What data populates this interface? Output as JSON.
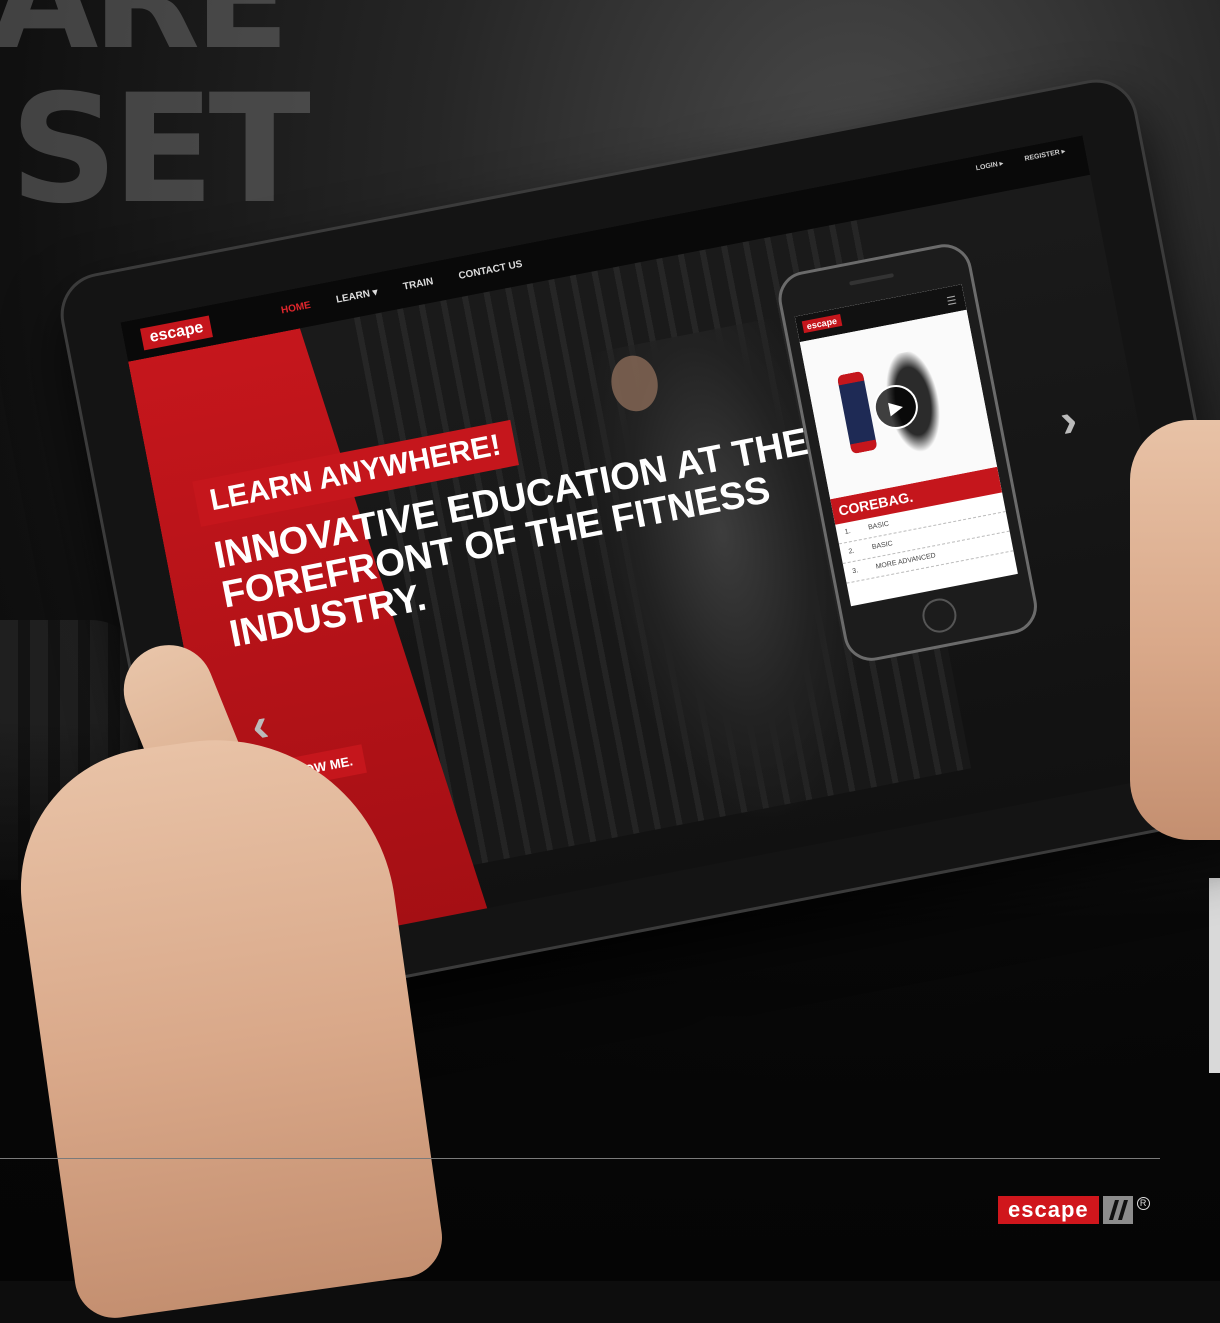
{
  "tablet_site": {
    "logo": "escape",
    "nav": [
      "HOME",
      "LEARN ▾",
      "TRAIN",
      "CONTACT US"
    ],
    "top_links": [
      "LOGIN ▸",
      "REGISTER ▸"
    ],
    "ribbon": "LEARN ANYWHERE!",
    "headline": "INNOVATIVE EDUCATION AT THE FOREFRONT OF THE FITNESS INDUSTRY.",
    "cta": "SHOW ME.",
    "prev_icon": "‹",
    "next_icon": "›"
  },
  "phone_site": {
    "logo": "escape",
    "menu_icon": "☰",
    "play_icon": "▶",
    "title": "COREBAG.",
    "rows": [
      {
        "num": "1.",
        "text": "BASIC"
      },
      {
        "num": "2.",
        "text": "BASIC"
      },
      {
        "num": "3.",
        "text": "MORE ADVANCED"
      }
    ]
  },
  "footer": {
    "logo_text": "escape",
    "registered": "R"
  },
  "colors": {
    "brand_red": "#c5161c",
    "background": "#0d0d0d"
  }
}
